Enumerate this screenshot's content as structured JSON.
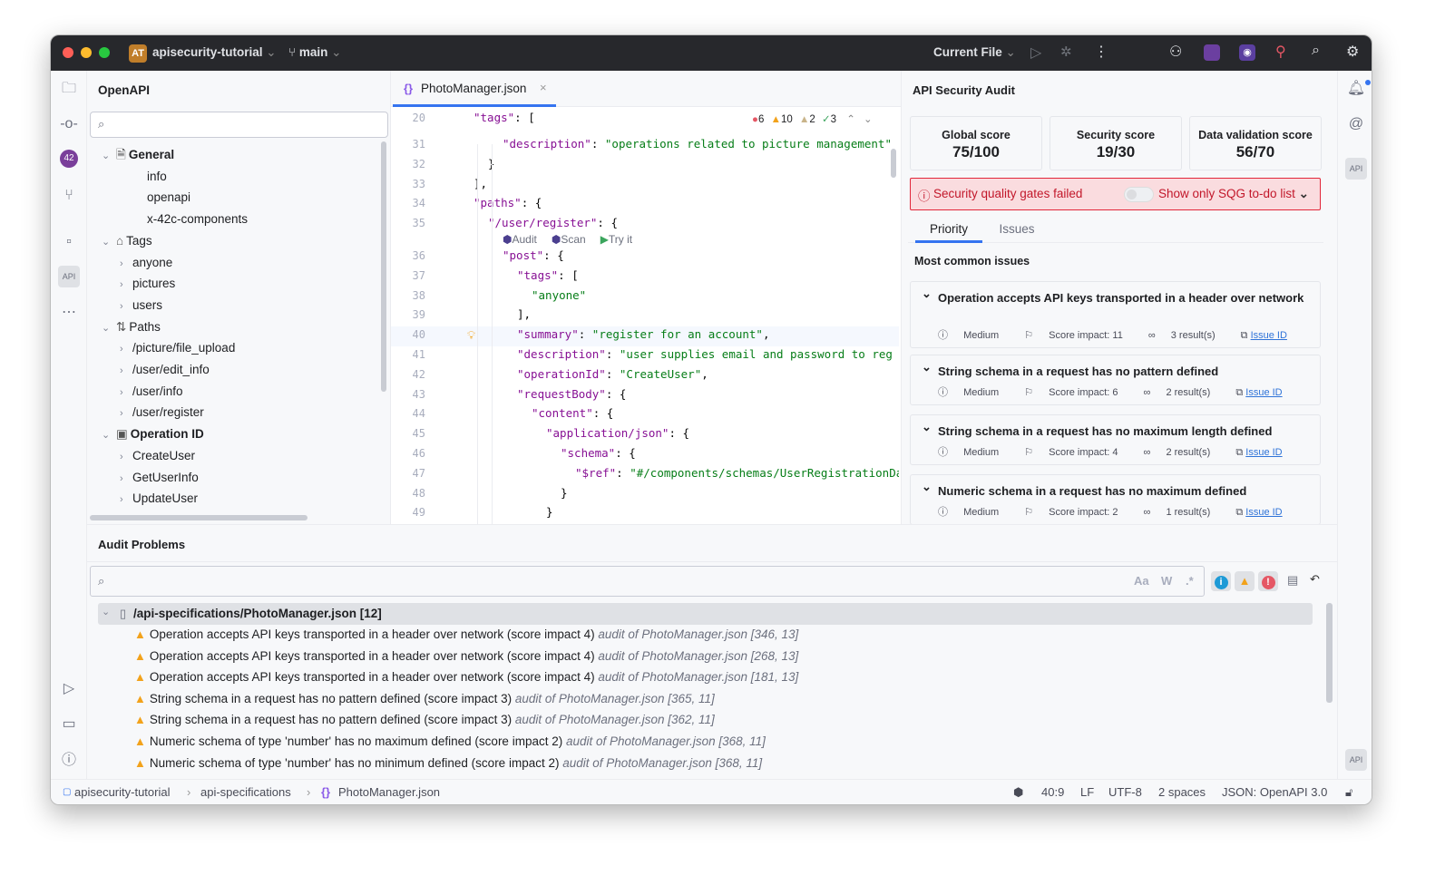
{
  "titlebar": {
    "project_badge": "AT",
    "project": "apisecurity-tutorial",
    "branch": "main",
    "run_config": "Current File",
    "icons": [
      "run-icon",
      "debug-icon",
      "more-icon",
      "add-user-icon",
      "audit-plugin-icon",
      "scan-plugin-icon",
      "code-search-icon",
      "search-icon",
      "settings-icon"
    ]
  },
  "project_panel": {
    "title": "OpenAPI",
    "search_placeholder": "",
    "tree": [
      {
        "label": "General",
        "level": 0,
        "expanded": true,
        "bold": true,
        "icon": "document-icon"
      },
      {
        "label": "info",
        "level": 1
      },
      {
        "label": "openapi",
        "level": 1
      },
      {
        "label": "x-42c-components",
        "level": 1
      },
      {
        "label": "Tags",
        "level": 0,
        "expanded": true,
        "bold": false,
        "icon": "tag-icon"
      },
      {
        "label": "anyone",
        "level": 1,
        "collapsed": true
      },
      {
        "label": "pictures",
        "level": 1,
        "collapsed": true
      },
      {
        "label": "users",
        "level": 1,
        "collapsed": true
      },
      {
        "label": "Paths",
        "level": 0,
        "expanded": true,
        "bold": false,
        "icon": "paths-icon"
      },
      {
        "label": "/picture/file_upload",
        "level": 1,
        "collapsed": true
      },
      {
        "label": "/user/edit_info",
        "level": 1,
        "collapsed": true
      },
      {
        "label": "/user/info",
        "level": 1,
        "collapsed": true
      },
      {
        "label": "/user/register",
        "level": 1,
        "collapsed": true
      },
      {
        "label": "Operation ID",
        "level": 0,
        "expanded": true,
        "bold": true,
        "icon": "id-icon"
      },
      {
        "label": "CreateUser",
        "level": 1,
        "collapsed": true
      },
      {
        "label": "GetUserInfo",
        "level": 1,
        "collapsed": true
      },
      {
        "label": "UpdateUser",
        "level": 1,
        "collapsed": true
      }
    ]
  },
  "editor": {
    "tab": "PhotoManager.json",
    "inspections": {
      "errors": "6",
      "warnings": "10",
      "weak_warnings": "2",
      "ok": "3"
    },
    "codelens": [
      "Audit",
      "Scan",
      "Try it"
    ],
    "lines": [
      {
        "n": "20",
        "i": 1,
        "seg": [
          [
            "k",
            "\"tags\""
          ],
          [
            "p",
            ": ["
          ]
        ]
      },
      {
        "n": "31",
        "i": 3,
        "seg": [
          [
            "k",
            "\"description\""
          ],
          [
            "p",
            ": "
          ],
          [
            "s",
            "\"operations related to picture management\""
          ]
        ]
      },
      {
        "n": "32",
        "i": 2,
        "seg": [
          [
            "p",
            "}"
          ]
        ]
      },
      {
        "n": "33",
        "i": 1,
        "seg": [
          [
            "p",
            "],"
          ]
        ]
      },
      {
        "n": "34",
        "i": 1,
        "seg": [
          [
            "k",
            "\"paths\""
          ],
          [
            "p",
            ": {"
          ]
        ]
      },
      {
        "n": "35",
        "i": 2,
        "seg": [
          [
            "k",
            "\"/user/register\""
          ],
          [
            "p",
            ": {"
          ]
        ]
      },
      {
        "n": "36",
        "i": 3,
        "seg": [
          [
            "k",
            "\"post\""
          ],
          [
            "p",
            ": {"
          ]
        ]
      },
      {
        "n": "37",
        "i": 4,
        "seg": [
          [
            "k",
            "\"tags\""
          ],
          [
            "p",
            ": ["
          ]
        ]
      },
      {
        "n": "38",
        "i": 5,
        "seg": [
          [
            "s",
            "\"anyone\""
          ]
        ]
      },
      {
        "n": "39",
        "i": 4,
        "seg": [
          [
            "p",
            "],"
          ]
        ]
      },
      {
        "n": "40",
        "i": 4,
        "seg": [
          [
            "k",
            "\"summary\""
          ],
          [
            "p",
            ": "
          ],
          [
            "s",
            "\"register for an account\""
          ],
          [
            "p",
            ","
          ]
        ]
      },
      {
        "n": "41",
        "i": 4,
        "seg": [
          [
            "k",
            "\"description\""
          ],
          [
            "p",
            ": "
          ],
          [
            "s",
            "\"user supplies email and password to reg"
          ]
        ]
      },
      {
        "n": "42",
        "i": 4,
        "seg": [
          [
            "k",
            "\"operationId\""
          ],
          [
            "p",
            ": "
          ],
          [
            "s",
            "\"CreateUser\""
          ],
          [
            "p",
            ","
          ]
        ]
      },
      {
        "n": "43",
        "i": 4,
        "seg": [
          [
            "k",
            "\"requestBody\""
          ],
          [
            "p",
            ": {"
          ]
        ]
      },
      {
        "n": "44",
        "i": 5,
        "seg": [
          [
            "k",
            "\"content\""
          ],
          [
            "p",
            ": {"
          ]
        ]
      },
      {
        "n": "45",
        "i": 6,
        "seg": [
          [
            "k",
            "\"application/json\""
          ],
          [
            "p",
            ": {"
          ]
        ]
      },
      {
        "n": "46",
        "i": 7,
        "seg": [
          [
            "k",
            "\"schema\""
          ],
          [
            "p",
            ": {"
          ]
        ]
      },
      {
        "n": "47",
        "i": 8,
        "seg": [
          [
            "k",
            "\"$ref\""
          ],
          [
            "p",
            ": "
          ],
          [
            "s",
            "\"#/components/schemas/UserRegistrationDa"
          ]
        ]
      },
      {
        "n": "48",
        "i": 7,
        "seg": [
          [
            "p",
            "}"
          ]
        ]
      },
      {
        "n": "49",
        "i": 6,
        "seg": [
          [
            "p",
            "}"
          ]
        ]
      }
    ]
  },
  "audit": {
    "title": "API Security Audit",
    "scores": [
      {
        "label": "Global score",
        "value": "75/100"
      },
      {
        "label": "Security score",
        "value": "19/30"
      },
      {
        "label": "Data validation score",
        "value": "56/70"
      }
    ],
    "sqg": {
      "message": "Security quality gates failed",
      "toggle_label": "Show only SQG to-do list",
      "toggle_on": false
    },
    "tabs": [
      {
        "label": "Priority",
        "active": true
      },
      {
        "label": "Issues",
        "active": false
      }
    ],
    "section": "Most common issues",
    "issues": [
      {
        "title": "Operation accepts API keys transported in a header over network",
        "severity": "Medium",
        "impact": "Score impact: 11",
        "results": "3 result(s)",
        "link": "Issue ID"
      },
      {
        "title": "String schema in a request has no pattern defined",
        "severity": "Medium",
        "impact": "Score impact: 6",
        "results": "2 result(s)",
        "link": "Issue ID"
      },
      {
        "title": "String schema in a request has no maximum length defined",
        "severity": "Medium",
        "impact": "Score impact: 4",
        "results": "2 result(s)",
        "link": "Issue ID"
      },
      {
        "title": "Numeric schema in a request has no maximum defined",
        "severity": "Medium",
        "impact": "Score impact: 2",
        "results": "1 result(s)",
        "link": "Issue ID"
      }
    ]
  },
  "problems": {
    "title": "Audit Problems",
    "search_placeholder": "",
    "options": [
      "Aa",
      "W",
      ".*"
    ],
    "file": "/api-specifications/PhotoManager.json [12]",
    "rows": [
      {
        "text": "Operation accepts API keys transported in a header over network (score impact 4)",
        "loc": "audit of PhotoManager.json [346, 13]"
      },
      {
        "text": "Operation accepts API keys transported in a header over network (score impact 4)",
        "loc": "audit of PhotoManager.json [268, 13]"
      },
      {
        "text": "Operation accepts API keys transported in a header over network (score impact 4)",
        "loc": "audit of PhotoManager.json [181, 13]"
      },
      {
        "text": "String schema in a request has no pattern defined (score impact 3)",
        "loc": "audit of PhotoManager.json [365, 11]"
      },
      {
        "text": "String schema in a request has no pattern defined (score impact 3)",
        "loc": "audit of PhotoManager.json [362, 11]"
      },
      {
        "text": "Numeric schema of type 'number' has no maximum defined (score impact 2)",
        "loc": "audit of PhotoManager.json [368, 11]"
      },
      {
        "text": "Numeric schema of type 'number' has no minimum defined (score impact 2)",
        "loc": "audit of PhotoManager.json [368, 11]"
      }
    ]
  },
  "statusbar": {
    "breadcrumb": [
      "apisecurity-tutorial",
      "api-specifications",
      "PhotoManager.json"
    ],
    "position": "40:9",
    "line_ending": "LF",
    "encoding": "UTF-8",
    "indent": "2 spaces",
    "file_type": "JSON: OpenAPI 3.0"
  },
  "colors": {
    "accent": "#3574f0",
    "error": "#e55765",
    "warning": "#f2a21b",
    "sqg_bg": "#fadcdf",
    "sqg_border": "#e2263a",
    "titlebar": "#27282c"
  }
}
